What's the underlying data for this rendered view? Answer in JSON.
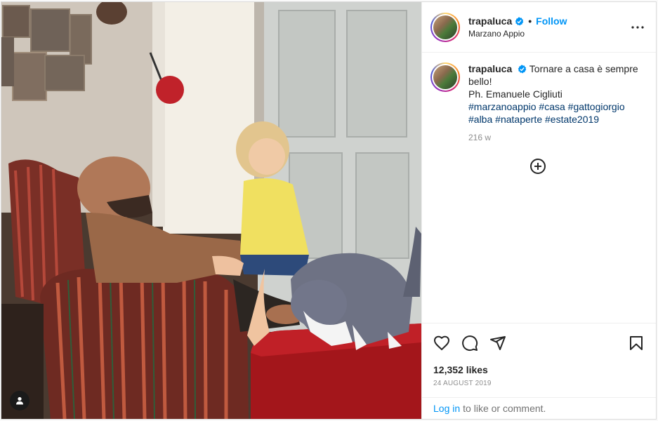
{
  "post": {
    "username": "trapaluca",
    "follow_label": "Follow",
    "separator": "•",
    "location": "Marzano Appio",
    "caption_text": "Tornare a casa è sempre bello!",
    "caption_credit": "Ph. Emanuele Cigliuti",
    "hashtags": [
      "#marzanoappio",
      "#casa",
      "#gattogiorgio",
      "#alba",
      "#nataperte",
      "#estate2019"
    ],
    "relative_time": "216 w",
    "likes_text": "12,352 likes",
    "date_text": "24 AUGUST 2019",
    "login_link": "Log in",
    "login_suffix": "to like or comment."
  },
  "icons": {
    "verified": "verified-badge-icon",
    "more": "more-options-icon",
    "add_comments": "plus-circle-icon",
    "like": "heart-icon",
    "comment": "comment-icon",
    "share": "share-icon",
    "save": "bookmark-icon",
    "user_tags": "user-icon"
  },
  "colors": {
    "link_blue": "#0095f6",
    "hashtag_blue": "#00376b",
    "muted": "#8e8e8e"
  }
}
